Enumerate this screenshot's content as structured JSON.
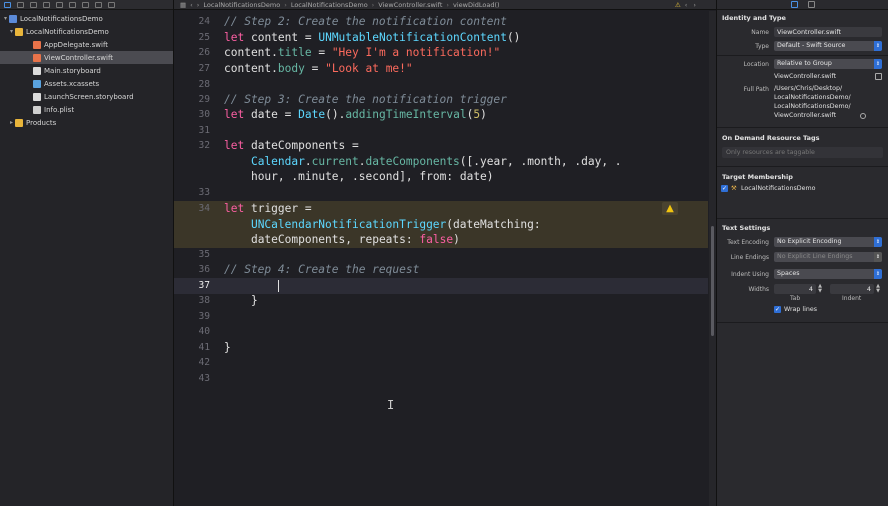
{
  "navigator": {
    "rows": [
      {
        "label": "LocalNotificationsDemo",
        "disc": "▾",
        "icon": "project"
      },
      {
        "label": "LocalNotificationsDemo",
        "disc": "▾",
        "icon": "folder"
      },
      {
        "label": "AppDelegate.swift",
        "disc": "",
        "icon": "swift"
      },
      {
        "label": "ViewController.swift",
        "disc": "",
        "icon": "swift"
      },
      {
        "label": "Main.storyboard",
        "disc": "",
        "icon": "storyboard"
      },
      {
        "label": "Assets.xcassets",
        "disc": "",
        "icon": "assets"
      },
      {
        "label": "LaunchScreen.storyboard",
        "disc": "",
        "icon": "storyboard"
      },
      {
        "label": "Info.plist",
        "disc": "",
        "icon": "plist"
      },
      {
        "label": "Products",
        "disc": "▸",
        "icon": "folder"
      }
    ]
  },
  "jumpbar": {
    "crumb1": "LocalNotificationsDemo",
    "crumb2": "LocalNotificationsDemo",
    "crumb3": "ViewController.swift",
    "crumb4": "viewDidLoad()"
  },
  "code": {
    "lines": [
      {
        "n": "24",
        "t": "        // Step 2: Create the notification content"
      },
      {
        "n": "25",
        "t": "        let content = UNMutableNotificationContent()"
      },
      {
        "n": "26",
        "t": "        content.title = \"Hey I'm a notification!\""
      },
      {
        "n": "27",
        "t": "        content.body = \"Look at me!\""
      },
      {
        "n": "28",
        "t": ""
      },
      {
        "n": "29",
        "t": "        // Step 3: Create the notification trigger"
      },
      {
        "n": "30",
        "t": "        let date = Date().addingTimeInterval(5)"
      },
      {
        "n": "31",
        "t": ""
      },
      {
        "n": "32a",
        "t": "        let dateComponents ="
      },
      {
        "n": "32b",
        "t": "            Calendar.current.dateComponents([.year, .month, .day, ."
      },
      {
        "n": "32c",
        "t": "            hour, .minute, .second], from: date)"
      },
      {
        "n": "33",
        "t": ""
      },
      {
        "n": "34a",
        "t": "        let trigger ="
      },
      {
        "n": "34b",
        "t": "            UNCalendarNotificationTrigger(dateMatching:"
      },
      {
        "n": "34c",
        "t": "            dateComponents, repeats: false)"
      },
      {
        "n": "35",
        "t": ""
      },
      {
        "n": "36",
        "t": "        // Step 4: Create the request"
      },
      {
        "n": "37",
        "t": ""
      },
      {
        "n": "38",
        "t": "    }"
      },
      {
        "n": "39",
        "t": ""
      },
      {
        "n": "40",
        "t": ""
      },
      {
        "n": "41",
        "t": "}"
      },
      {
        "n": "42",
        "t": ""
      },
      {
        "n": "43",
        "t": ""
      }
    ]
  },
  "inspector": {
    "identity_title": "Identity and Type",
    "name_label": "Name",
    "name_value": "ViewController.swift",
    "type_label": "Type",
    "type_value": "Default - Swift Source",
    "location_label": "Location",
    "location_value": "Relative to Group",
    "location_file": "ViewController.swift",
    "fullpath_label": "Full Path",
    "fullpath_l1": "/Users/Chris/Desktop/",
    "fullpath_l2": "LocalNotificationsDemo/",
    "fullpath_l3": "LocalNotificationsDemo/",
    "fullpath_l4": "ViewController.swift",
    "odr_title": "On Demand Resource Tags",
    "odr_placeholder": "Only resources are taggable",
    "target_title": "Target Membership",
    "target_name": "LocalNotificationsDemo",
    "text_title": "Text Settings",
    "encoding_label": "Text Encoding",
    "encoding_value": "No Explicit Encoding",
    "endings_label": "Line Endings",
    "endings_value": "No Explicit Line Endings",
    "indent_label": "Indent Using",
    "indent_value": "Spaces",
    "widths_label": "Widths",
    "tab_value": "4",
    "indent_width_value": "4",
    "tab_label": "Tab",
    "indent_sub_label": "Indent",
    "wrap_label": "Wrap lines"
  }
}
